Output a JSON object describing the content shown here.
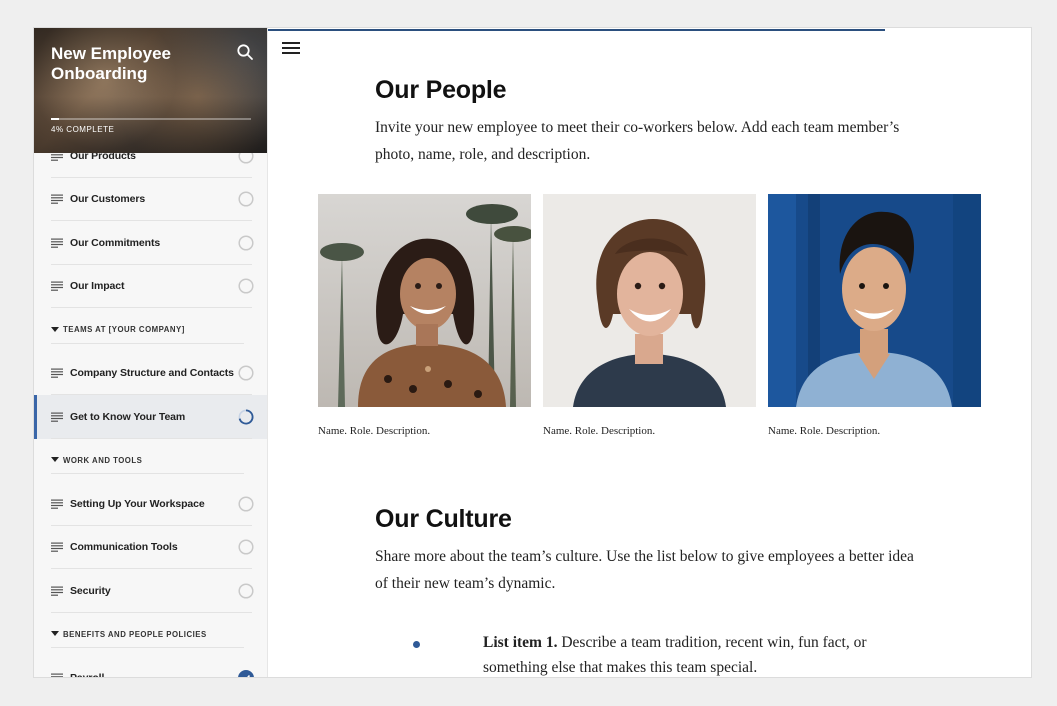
{
  "course": {
    "title": "New Employee Onboarding",
    "progress_label": "4% COMPLETE",
    "progress_fraction": 0.04
  },
  "sidebar": {
    "items": [
      {
        "label": "Our Products",
        "status": "incomplete"
      },
      {
        "label": "Our Customers",
        "status": "incomplete"
      },
      {
        "label": "Our Commitments",
        "status": "incomplete"
      },
      {
        "label": "Our Impact",
        "status": "incomplete"
      },
      {
        "section": "TEAMS AT [YOUR COMPANY]"
      },
      {
        "label": "Company Structure and Contacts",
        "status": "incomplete"
      },
      {
        "label": "Get to Know Your Team",
        "status": "in-progress"
      },
      {
        "section": "WORK AND TOOLS"
      },
      {
        "label": "Setting Up Your Workspace",
        "status": "incomplete"
      },
      {
        "label": "Communication Tools",
        "status": "incomplete"
      },
      {
        "label": "Security",
        "status": "incomplete"
      },
      {
        "section": "BENEFITS AND PEOPLE POLICIES"
      },
      {
        "label": "Payroll",
        "status": "complete"
      }
    ]
  },
  "main": {
    "people": {
      "title": "Our People",
      "body": "Invite your new employee to meet their co-workers below. Add each team member’s photo, name, role, and description.",
      "cards": [
        {
          "caption": "Name. Role. Description."
        },
        {
          "caption": "Name. Role. Description."
        },
        {
          "caption": "Name. Role. Description."
        }
      ]
    },
    "culture": {
      "title": "Our Culture",
      "body": "Share more about the team’s culture. Use the list below to give employees a better idea of their new team’s dynamic.",
      "list": [
        {
          "lead": "List item 1.",
          "text": " Describe a team tradition, recent win, fun fact, or something else that makes this team special."
        }
      ]
    }
  },
  "colors": {
    "accent": "#2f5a97",
    "active_bar": "#3a66a8",
    "top_progress": "#2b4f7e"
  }
}
